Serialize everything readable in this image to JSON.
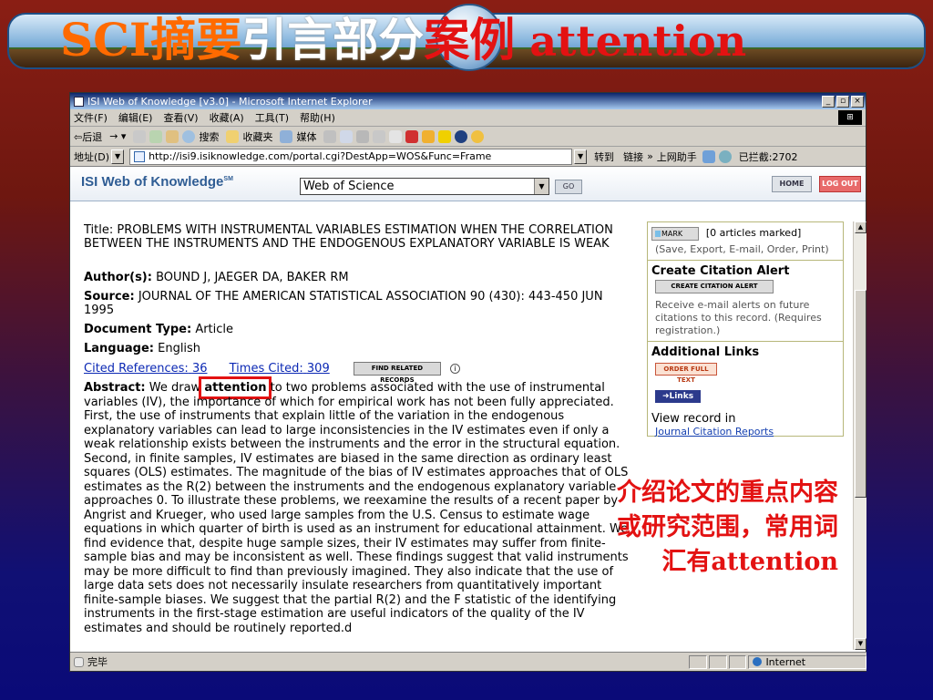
{
  "slide": {
    "title_part1": "SCI",
    "title_part2": "摘要",
    "title_part3": "引言部分",
    "title_part4": "案例",
    "title_part5": " attention",
    "annotation_line1": "介绍论文的重点内容",
    "annotation_line2": "或研究范围，常用词",
    "annotation_line3": "汇有attention"
  },
  "browser": {
    "window_title": "ISI Web of Knowledge [v3.0] - Microsoft Internet Explorer",
    "window_buttons": [
      "_",
      "▫",
      "×"
    ],
    "menu": [
      "文件(F)",
      "编辑(E)",
      "查看(V)",
      "收藏(A)",
      "工具(T)",
      "帮助(H)"
    ],
    "toolbar": {
      "back": "⇦后退",
      "search": "搜索",
      "favorites": "收藏夹",
      "media": "媒体"
    },
    "address_label": "地址(D)",
    "address_value": "http://isi9.isiknowledge.com/portal.cgi?DestApp=WOS&Func=Frame",
    "go_label": "转到",
    "links_label": "链接",
    "online_helper": "上网助手",
    "blocked_label": "已拦截:2702",
    "status_text": "完毕",
    "zone_text": "Internet"
  },
  "isi": {
    "logo": "ISI Web of Knowledge",
    "logo_sup": "SM",
    "database": "Web of Science",
    "go_btn": "GO",
    "home_btn": "HOME",
    "logout_btn": "LOG OUT"
  },
  "record": {
    "title_label": "Title:",
    "title_value": "PROBLEMS WITH INSTRUMENTAL VARIABLES ESTIMATION WHEN THE CORRELATION BETWEEN THE INSTRUMENTS AND THE ENDOGENOUS EXPLANATORY VARIABLE IS WEAK",
    "author_label": "Author(s):",
    "author_value": "BOUND J, JAEGER DA, BAKER RM",
    "source_label": "Source:",
    "source_value": "JOURNAL OF THE AMERICAN STATISTICAL ASSOCIATION",
    "source_detail": "90 (430): 443-450 JUN 1995",
    "doctype_label": "Document Type:",
    "doctype_value": "Article",
    "language_label": "Language:",
    "language_value": "English",
    "cited_refs_label": "Cited References:",
    "cited_refs_value": "36",
    "times_cited_label": "Times Cited:",
    "times_cited_value": "309",
    "related_btn": "FIND RELATED RECORDS",
    "info_icon_glyph": "i",
    "abstract_label": "Abstract:",
    "abstract_pre": "We draw",
    "abstract_highlight": "attention",
    "abstract_post": "to two problems associated with the use of instrumental variables (IV), the importance of which for empirical work has not been fully appreciated. First, the use of instruments that explain little of the variation in the endogenous explanatory variables can lead to large inconsistencies in the IV estimates even if only a weak relationship exists between the instruments and the error in the structural equation. Second, in finite samples, IV estimates are biased in the same direction as ordinary least squares (OLS) estimates. The magnitude of the bias of IV estimates approaches that of OLS estimates as the R(2) between the instruments and the endogenous explanatory variable approaches 0. To illustrate these problems, we reexamine the results of a recent paper by Angrist and Krueger, who used large samples from the U.S. Census to estimate wage equations in which quarter of birth is used as an instrument for educational attainment. We find evidence that, despite huge sample sizes, their IV estimates may suffer from finite-sample bias and may be inconsistent as well. These findings suggest that valid instruments may be more difficult to find than previously imagined. They also indicate that the use of large data sets does not necessarily insulate researchers from quantitatively important finite-sample biases. We suggest that the partial R(2) and the F statistic of the identifying instruments in the first-stage estimation are useful indicators of the quality of the IV estimates and should be routinely reported.d"
  },
  "sidebar": {
    "mark_btn": "MARK",
    "marked_text": "[0 articles marked]",
    "save_text": "(Save, Export, E-mail, Order, Print)",
    "alert_heading": "Create Citation Alert",
    "alert_btn": "CREATE CITATION ALERT",
    "alert_desc": "Receive e-mail alerts on future citations to this record. (Requires registration.)",
    "links_heading": "Additional Links",
    "order_btn": "ORDER FULL TEXT",
    "links_btn": "➜Links",
    "view_heading": "View record in",
    "jcr_link": "Journal Citation Reports"
  }
}
